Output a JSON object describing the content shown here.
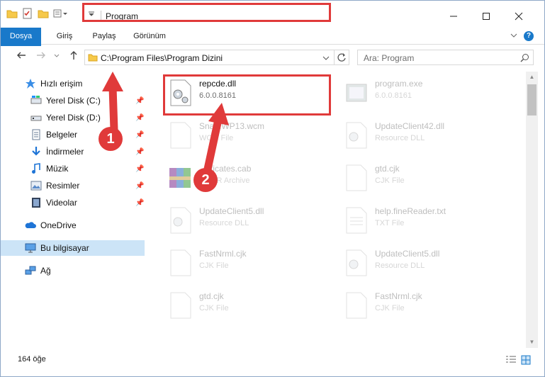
{
  "window": {
    "title": "Program"
  },
  "ribbon": {
    "tabs": [
      "Dosya",
      "Giriş",
      "Paylaş",
      "Görünüm"
    ],
    "help_label": "?"
  },
  "navbar": {
    "path": "C:\\Program Files\\Program Dizini",
    "search_placeholder": "Ara: Program"
  },
  "sidebar": {
    "items": [
      {
        "label": "Hızlı erişim",
        "icon": "star-icon"
      },
      {
        "label": "Yerel Disk (C:)",
        "icon": "drive-icon"
      },
      {
        "label": "Yerel Disk (D:)",
        "icon": "drive-icon"
      },
      {
        "label": "Belgeler",
        "icon": "documents-icon"
      },
      {
        "label": "İndirmeler",
        "icon": "download-icon"
      },
      {
        "label": "Müzik",
        "icon": "music-icon"
      },
      {
        "label": "Resimler",
        "icon": "pictures-icon"
      },
      {
        "label": "Videolar",
        "icon": "videos-icon"
      },
      {
        "label": "OneDrive",
        "icon": "cloud-icon"
      },
      {
        "label": "Bu bilgisayar",
        "icon": "computer-icon"
      },
      {
        "label": "Ağ",
        "icon": "network-icon"
      }
    ]
  },
  "files": [
    {
      "name": "repcde.dll",
      "desc": "6.0.0.8161"
    },
    {
      "name": "program.exe",
      "desc": "6.0.0.8161"
    },
    {
      "name": "Sna...WP13.wcm",
      "desc": "WCM File"
    },
    {
      "name": "UpdateClient42.dll",
      "desc": "Resource DLL"
    },
    {
      "name": "...tificates.cab",
      "desc": "...RAR Archive"
    },
    {
      "name": "gtd.cjk",
      "desc": "CJK File"
    },
    {
      "name": "UpdateClient5.dll",
      "desc": "Resource DLL"
    },
    {
      "name": "help.fineReader.txt",
      "desc": "TXT File"
    },
    {
      "name": "FastNrml.cjk",
      "desc": "CJK File"
    },
    {
      "name": "UpdateClient5.dll",
      "desc": "Resource DLL"
    },
    {
      "name": "gtd.cjk",
      "desc": "CJK File"
    },
    {
      "name": "FastNrml.cjk",
      "desc": "CJK File"
    }
  ],
  "status": {
    "count": "164 öğe"
  },
  "annotations": {
    "step1": "1",
    "step2": "2"
  },
  "colors": {
    "accent": "#1979ca",
    "highlight": "#e03a3a",
    "selection": "#cce4f7"
  }
}
